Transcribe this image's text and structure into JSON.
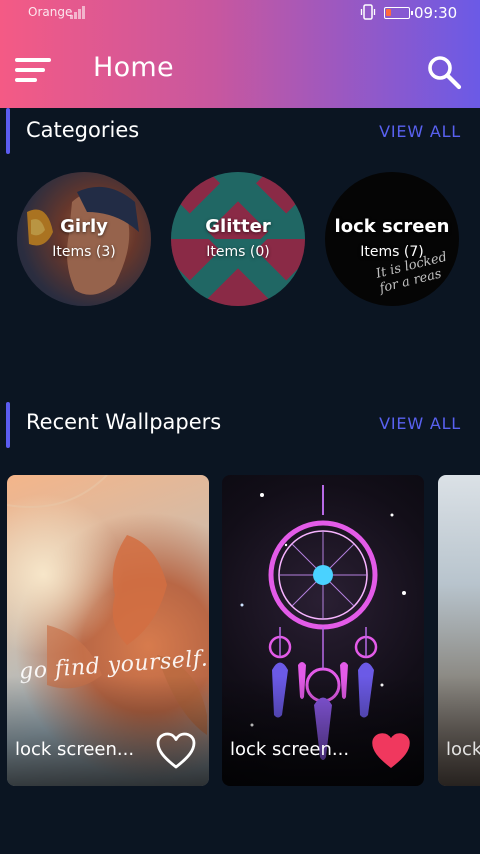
{
  "status_bar": {
    "carrier": "Orange",
    "time": "09:30",
    "battery_level": 0.25,
    "battery_color": "#ff6a3d"
  },
  "app_bar": {
    "title": "Home",
    "menu_icon": "hamburger-menu-icon",
    "search_icon": "search-icon"
  },
  "categories": {
    "title": "Categories",
    "view_all": "VIEW ALL",
    "items": [
      {
        "name": "Girly",
        "count": "Items (3)"
      },
      {
        "name": "Glitter",
        "count": "Items (0)"
      },
      {
        "name": "lock screen",
        "count": "Items (7)",
        "image_text": "It is locked for a reason"
      }
    ]
  },
  "recent": {
    "title": "Recent Wallpapers",
    "view_all": "VIEW ALL",
    "items": [
      {
        "title": "lock screen...",
        "favorited": false,
        "image_text": "go find yourself."
      },
      {
        "title": "lock screen...",
        "favorited": true
      },
      {
        "title": "lock"
      }
    ]
  },
  "colors": {
    "accent": "#5b5cf0",
    "view_all": "#5961f0",
    "background": "#0b1522",
    "heart_active": "#f0385e",
    "gradient_start": "#f45a85",
    "gradient_end": "#6b5ae6"
  }
}
